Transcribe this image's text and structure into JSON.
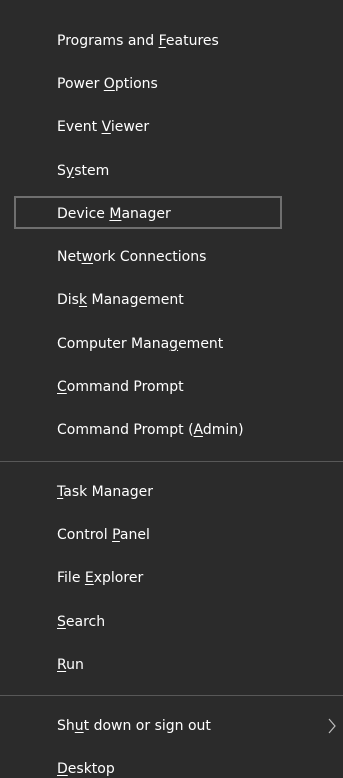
{
  "menu": {
    "group1": [
      {
        "before": "Programs and ",
        "key": "F",
        "after": "eatures"
      },
      {
        "before": "Power ",
        "key": "O",
        "after": "ptions"
      },
      {
        "before": "Event ",
        "key": "V",
        "after": "iewer"
      },
      {
        "before": "S",
        "key": "y",
        "after": "stem"
      },
      {
        "before": "Device ",
        "key": "M",
        "after": "anager"
      },
      {
        "before": "Net",
        "key": "w",
        "after": "ork Connections"
      },
      {
        "before": "Dis",
        "key": "k",
        "after": " Management"
      },
      {
        "before": "Computer Mana",
        "key": "g",
        "after": "ement"
      },
      {
        "before": "",
        "key": "C",
        "after": "ommand Prompt"
      },
      {
        "before": "Command Prompt (",
        "key": "A",
        "after": "dmin)"
      }
    ],
    "group2": [
      {
        "before": "",
        "key": "T",
        "after": "ask Manager"
      },
      {
        "before": "Control ",
        "key": "P",
        "after": "anel"
      },
      {
        "before": "File ",
        "key": "E",
        "after": "xplorer"
      },
      {
        "before": "",
        "key": "S",
        "after": "earch"
      },
      {
        "before": "",
        "key": "R",
        "after": "un"
      }
    ],
    "group3": [
      {
        "before": "Sh",
        "key": "u",
        "after": "t down or sign out"
      },
      {
        "before": "",
        "key": "D",
        "after": "esktop"
      }
    ],
    "chevron_icon": "chevron-right-icon",
    "colors": {
      "background": "#2b2b2b",
      "text": "#ffffff",
      "highlight_border": "#6f6f6f",
      "divider": "#585858"
    }
  }
}
